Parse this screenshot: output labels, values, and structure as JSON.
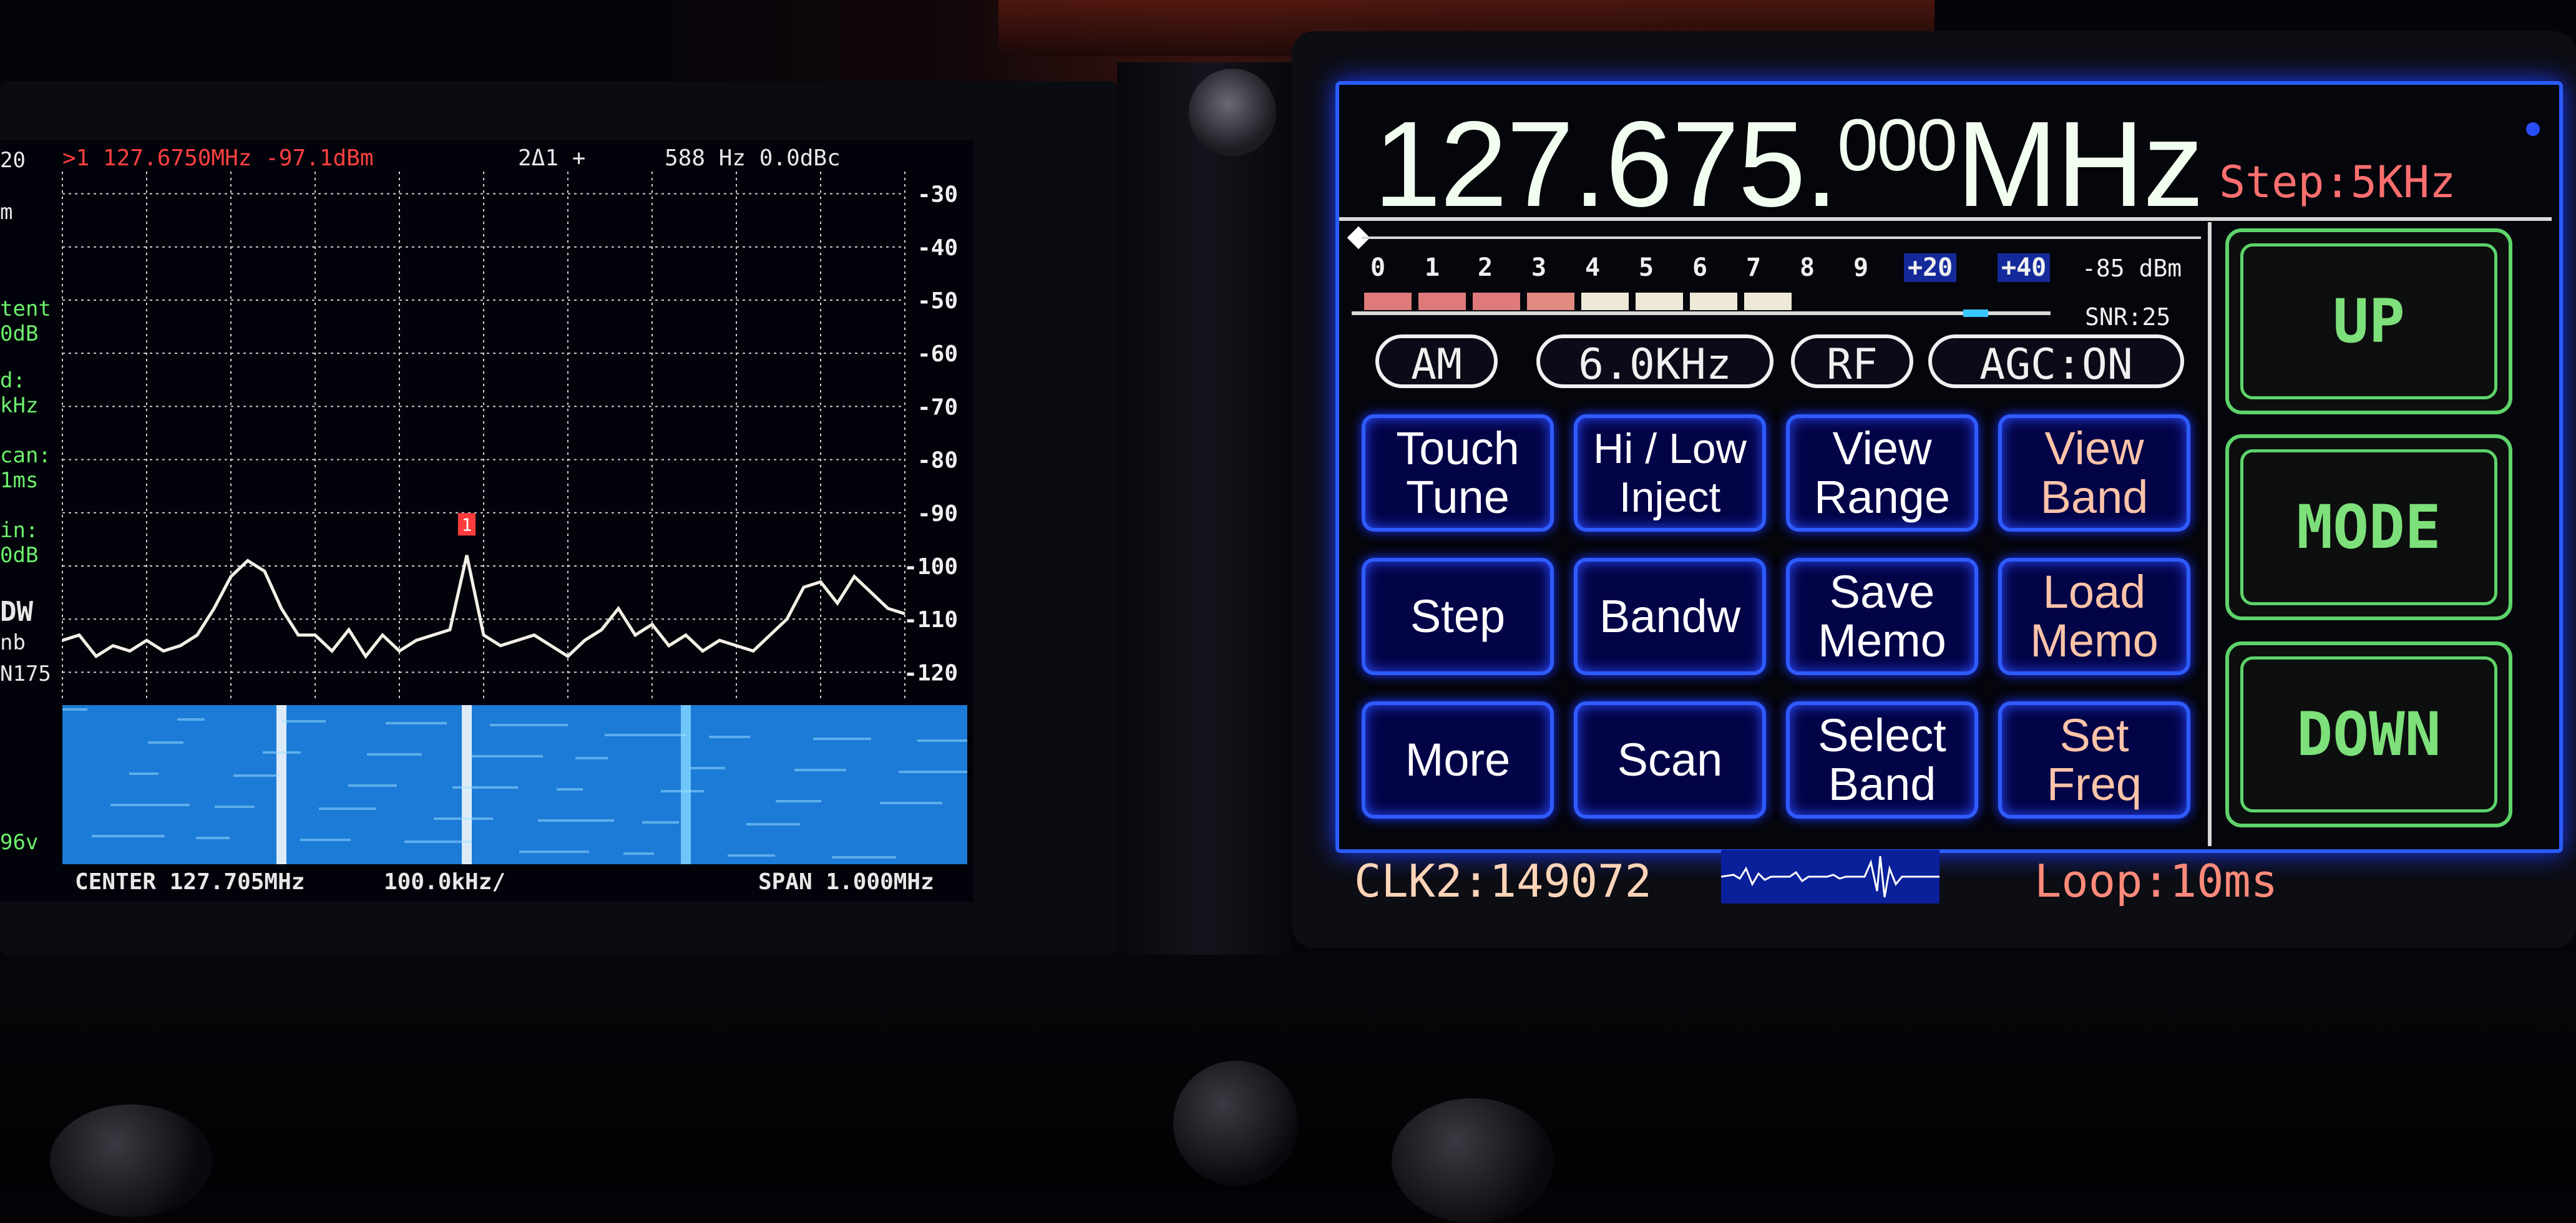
{
  "spectrum": {
    "left_labels": [
      "20",
      "m",
      "tent",
      "0dB",
      "d:",
      "kHz",
      "can:",
      "1ms",
      "in:",
      "0dB",
      "DW",
      "nb",
      "N175",
      "96v"
    ],
    "marker_info": ">1 127.6750MHz -97.1dBm",
    "delta_info": "2Δ1 +",
    "delta_values": "588 Hz 0.0dBc",
    "y_ticks": [
      "-30",
      "-40",
      "-50",
      "-60",
      "-70",
      "-80",
      "-90",
      "-100",
      "-110",
      "-120"
    ],
    "marker_num": "1",
    "center_label": "CENTER 127.705MHz",
    "div_label": "100.0kHz/",
    "span_label": "SPAN 1.000MHz",
    "colors": {
      "trace": "#f4f0e6",
      "marker": "#ff3b3b",
      "waterfall": "#1b7bd6"
    }
  },
  "chart_data": {
    "type": "line",
    "ylim": [
      -125,
      -27
    ],
    "y_ticks": [
      -30,
      -40,
      -50,
      -60,
      -70,
      -80,
      -90,
      -100,
      -110,
      -120
    ],
    "x": [
      0,
      2,
      4,
      6,
      8,
      10,
      12,
      14,
      16,
      18,
      20,
      22,
      24,
      26,
      28,
      30,
      32,
      34,
      36,
      38,
      40,
      42,
      44,
      46,
      48,
      50,
      52,
      54,
      56,
      58,
      60,
      62,
      64,
      66,
      68,
      70,
      72,
      74,
      76,
      78,
      80,
      82,
      84,
      86,
      88,
      90,
      92,
      94,
      96,
      98,
      100
    ],
    "values": [
      -114,
      -113,
      -117,
      -115,
      -116,
      -114,
      -116,
      -115,
      -113,
      -108,
      -102,
      -99,
      -101,
      -108,
      -113,
      -113,
      -116,
      -112,
      -117,
      -113,
      -116,
      -114,
      -113,
      -112,
      -98,
      -113,
      -115,
      -114,
      -113,
      -115,
      -117,
      -114,
      -112,
      -108,
      -113,
      -111,
      -115,
      -113,
      -116,
      -114,
      -115,
      -116,
      -113,
      -110,
      -104,
      -103,
      -107,
      -102,
      -105,
      -108,
      -109
    ],
    "marker": {
      "x": 48,
      "value": -97.1
    }
  },
  "radio": {
    "freq_main": "127.675.",
    "freq_sub": "000",
    "freq_unit": "MHz",
    "step": "Step:5KHz",
    "smeter_labels": [
      "0",
      "1",
      "2",
      "3",
      "4",
      "5",
      "6",
      "7",
      "8",
      "9",
      "+20",
      "+40"
    ],
    "dbm": "-85 dBm",
    "snr": "SNR:25",
    "mode_pill": "AM",
    "bw_pill": "6.0KHz",
    "rf_pill": "RF",
    "agc_pill": "AGC:ON",
    "buttons": [
      {
        "line1": "Touch",
        "line2": "Tune"
      },
      {
        "line1": "Hi / Low",
        "line2": "Inject"
      },
      {
        "line1": "View",
        "line2": "Range"
      },
      {
        "line1": "View",
        "line2": "Band"
      },
      {
        "line1": "Step",
        "line2": ""
      },
      {
        "line1": "Bandw",
        "line2": ""
      },
      {
        "line1": "Save",
        "line2": "Memo"
      },
      {
        "line1": "Load",
        "line2": "Memo"
      },
      {
        "line1": "More",
        "line2": ""
      },
      {
        "line1": "Scan",
        "line2": ""
      },
      {
        "line1": "Select",
        "line2": "Band"
      },
      {
        "line1": "Set",
        "line2": "Freq"
      }
    ],
    "up": "UP",
    "mode": "MODE",
    "down": "DOWN",
    "clk": "CLK2:149072",
    "loop": "Loop:10ms",
    "colors": {
      "accent": "#2f5bff",
      "green": "#5ed36a",
      "step": "#ff6f6f"
    }
  }
}
